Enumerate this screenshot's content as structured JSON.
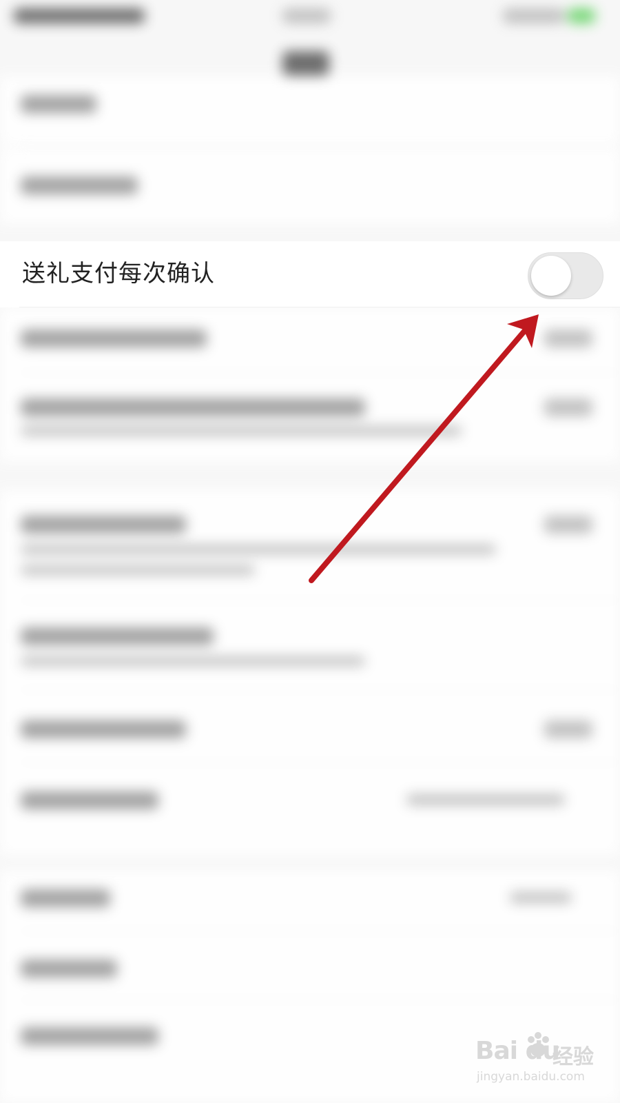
{
  "setting": {
    "label": "送礼支付每次确认",
    "toggle_state": "off"
  },
  "colors": {
    "arrow": "#c0191f",
    "toggle_track": "#e9e9e9",
    "background": "#f7f7f7"
  },
  "icons": {
    "arrow": "arrow-annotation-icon",
    "toggle": "toggle-switch"
  },
  "watermark": {
    "logo_text": "Bai du",
    "cn_text": "经验",
    "url": "jingyan.baidu.com"
  }
}
